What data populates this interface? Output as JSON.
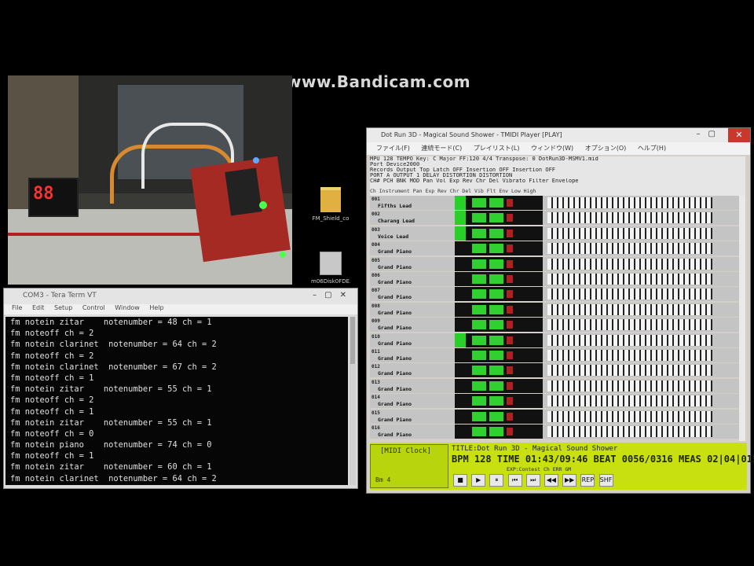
{
  "watermark": "www.Bandicam.com",
  "webcam": {
    "display_digits": "88"
  },
  "desktop_icons": [
    {
      "label": "FM_Shield_co"
    },
    {
      "label": "m06Disk0FDE..D"
    }
  ],
  "console": {
    "title": "COM3 - Tera Term VT",
    "menu": [
      "File",
      "Edit",
      "Setup",
      "Control",
      "Window",
      "Help"
    ],
    "lines": [
      "fm notein zitar    notenumber = 48 ch = 1",
      "fm noteoff ch = 2",
      "fm notein clarinet  notenumber = 64 ch = 2",
      "fm noteoff ch = 2",
      "fm notein clarinet  notenumber = 67 ch = 2",
      "fm noteoff ch = 1",
      "fm notein zitar    notenumber = 55 ch = 1",
      "fm noteoff ch = 2",
      "fm noteoff ch = 1",
      "fm notein zitar    notenumber = 55 ch = 1",
      "fm noteoff ch = 0",
      "fm notein piano    notenumber = 74 ch = 0",
      "fm noteoff ch = 1",
      "fm notein zitar    notenumber = 60 ch = 1",
      "fm notein clarinet  notenumber = 64 ch = 2"
    ]
  },
  "player": {
    "title": "Dot Run 3D - Magical Sound Shower - TMIDI Player [PLAY]",
    "menu": [
      "ファイル(F)",
      "連続モード(C)",
      "プレイリスト(L)",
      "ウィンドウ(W)",
      "オプション(O)",
      "ヘルプ(H)"
    ],
    "info_lines": [
      "MPU  128 TEMPO Key: C Major FF:120  4/4  Transpose: 0  DotRun3D-MSMV1.mid",
      "Port  Device2000",
      "Records  Output  Top Latch  OFF  Insertion  OFF  Insertion  OFF",
      "PORT A  OUTPUT 1  DELAY  DISTORTION  DISTORTION",
      "CH#  PCH  BNK  MOD  Pan  Vol  Exp  Rev  Chr  Del  Vibrato  Filter  Envelope"
    ],
    "header": "Ch  Instrument        Pan  Exp  Rev  Chr  Del  Vib  Flt  Env  Low  High",
    "tracks": [
      {
        "num": "001",
        "name": "Fifths Lead"
      },
      {
        "num": "002",
        "name": "Charang Lead"
      },
      {
        "num": "003",
        "name": "Voice Lead"
      },
      {
        "num": "004",
        "name": "Grand Piano"
      },
      {
        "num": "005",
        "name": "Grand Piano"
      },
      {
        "num": "006",
        "name": "Grand Piano"
      },
      {
        "num": "007",
        "name": "Grand Piano"
      },
      {
        "num": "008",
        "name": "Grand Piano"
      },
      {
        "num": "009",
        "name": "Grand Piano"
      },
      {
        "num": "010",
        "name": "Grand Piano"
      },
      {
        "num": "011",
        "name": "Grand Piano"
      },
      {
        "num": "012",
        "name": "Grand Piano"
      },
      {
        "num": "013",
        "name": "Grand Piano"
      },
      {
        "num": "014",
        "name": "Grand Piano"
      },
      {
        "num": "015",
        "name": "Grand Piano"
      },
      {
        "num": "016",
        "name": "Grand Piano"
      }
    ],
    "status": {
      "mode": "[MIDI Clock]",
      "mode_bottom": "Bm    4",
      "song_title": "TITLE:Dot Run 3D - Magical Sound Shower",
      "bpm_line": "BPM 128 TIME 01:43/09:46 BEAT 0056/0316 MEAS 02|04|0158/0480",
      "sub_line": "EXP:Contest    Ch    ERR    GM"
    },
    "transport": [
      "■",
      "▶",
      "⏸",
      "⏮",
      "⏭",
      "◀◀",
      "▶▶",
      "REP",
      "SHF"
    ]
  }
}
